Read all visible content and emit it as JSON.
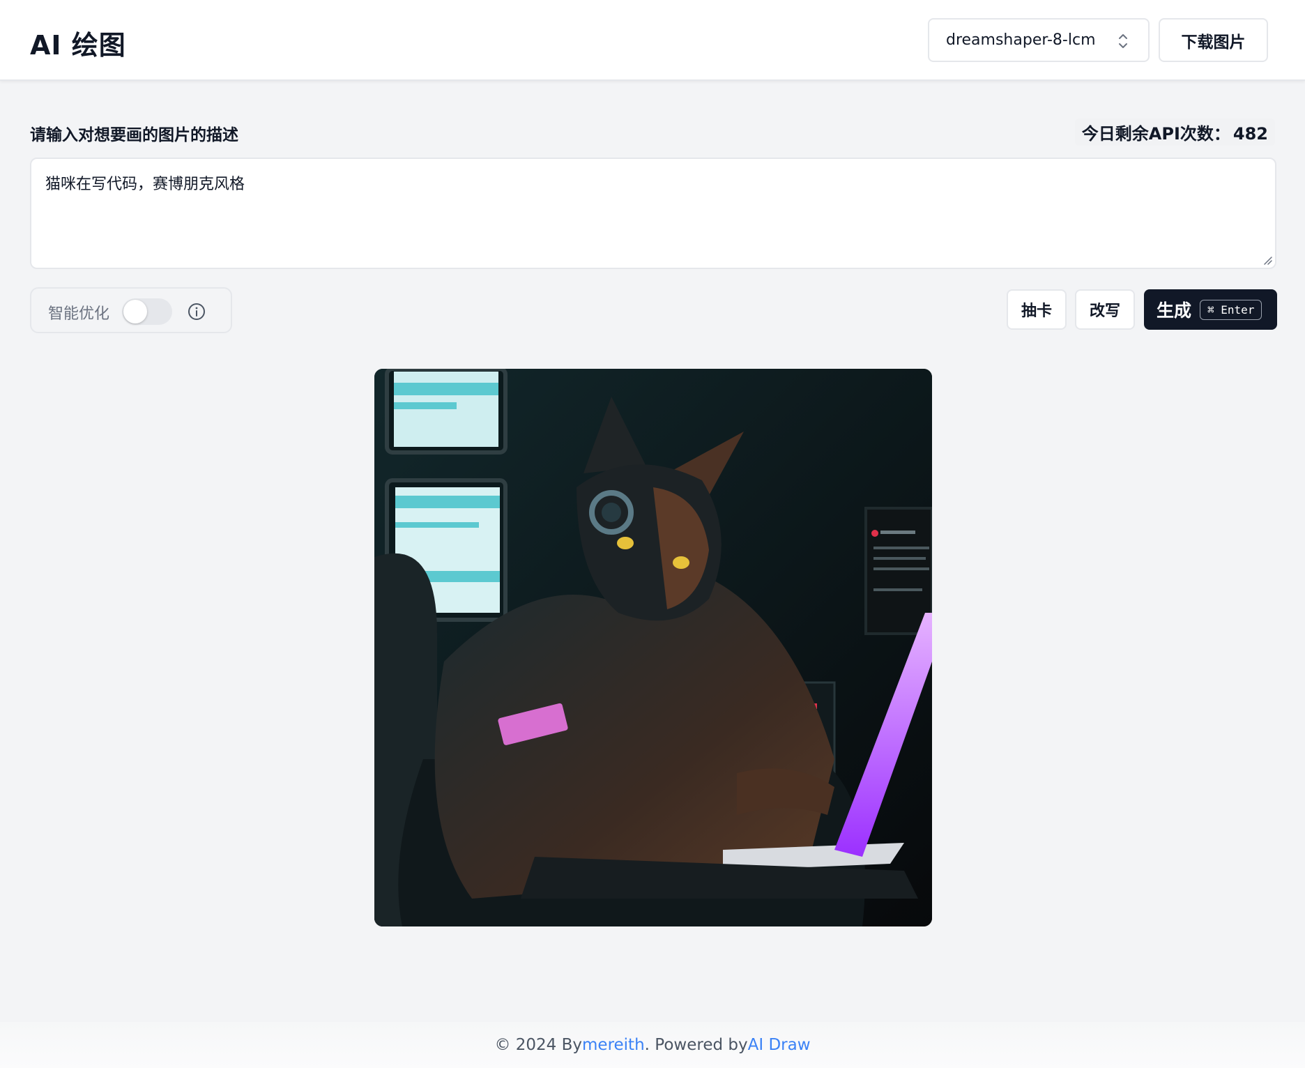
{
  "header": {
    "title": "AI 绘图",
    "model_select": {
      "value": "dreamshaper-8-lcm"
    },
    "download_label": "下载图片"
  },
  "prompt": {
    "label": "请输入对想要画的图片的描述",
    "quota_label": "今日剩余API次数：",
    "quota_value": "482",
    "value": "猫咪在写代码，赛博朋克风格"
  },
  "controls": {
    "smart_optimize_label": "智能优化",
    "smart_optimize_on": false,
    "draw_label": "抽卡",
    "rewrite_label": "改写",
    "generate_label": "生成",
    "generate_shortcut": "⌘ Enter"
  },
  "result": {
    "image_icon": "generated-image"
  },
  "footer": {
    "prefix": "© 2024 By ",
    "author": "mereith",
    "middle": ". Powered by ",
    "product": "AI Draw"
  },
  "colors": {
    "primary": "#111827",
    "link": "#3b82f6",
    "background": "#f3f4f6"
  }
}
